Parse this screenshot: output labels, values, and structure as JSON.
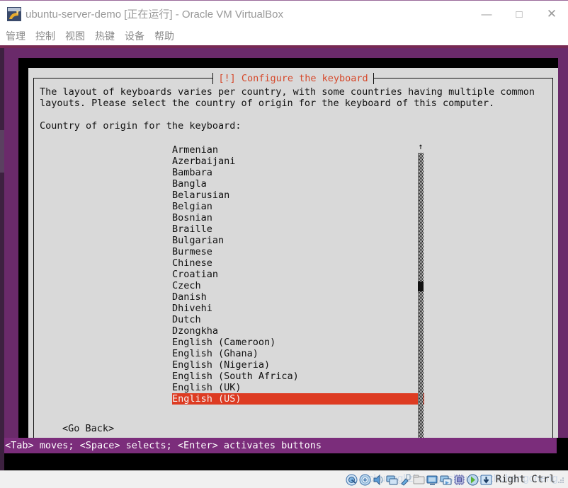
{
  "window": {
    "title": "ubuntu-server-demo [正在运行] - Oracle VM VirtualBox",
    "logo_icon": "virtualbox-logo-icon",
    "minimize_label": "—",
    "maximize_label": "□",
    "close_label": "✕",
    "minimize_icon": "minimize-icon",
    "maximize_icon": "maximize-icon",
    "close_icon": "close-icon"
  },
  "menubar": {
    "items": [
      {
        "label": "管理"
      },
      {
        "label": "控制"
      },
      {
        "label": "视图"
      },
      {
        "label": "热键"
      },
      {
        "label": "设备"
      },
      {
        "label": "帮助"
      }
    ]
  },
  "dialog": {
    "title": "[!] Configure the keyboard",
    "title_color": "#d6482a",
    "body_text": "The layout of keyboards varies per country, with some countries having multiple common\nlayouts. Please select the country of origin for the keyboard of this computer.",
    "prompt": "Country of origin for the keyboard:",
    "go_back_label": "<Go Back>",
    "selected_value": "English (US)",
    "highlight_color": "#dd3b22",
    "panel_color": "#d9d9d9",
    "list": [
      {
        "label": "Armenian",
        "selected": false
      },
      {
        "label": "Azerbaijani",
        "selected": false
      },
      {
        "label": "Bambara",
        "selected": false
      },
      {
        "label": "Bangla",
        "selected": false
      },
      {
        "label": "Belarusian",
        "selected": false
      },
      {
        "label": "Belgian",
        "selected": false
      },
      {
        "label": "Bosnian",
        "selected": false
      },
      {
        "label": "Braille",
        "selected": false
      },
      {
        "label": "Bulgarian",
        "selected": false
      },
      {
        "label": "Burmese",
        "selected": false
      },
      {
        "label": "Chinese",
        "selected": false
      },
      {
        "label": "Croatian",
        "selected": false
      },
      {
        "label": "Czech",
        "selected": false
      },
      {
        "label": "Danish",
        "selected": false
      },
      {
        "label": "Dhivehi",
        "selected": false
      },
      {
        "label": "Dutch",
        "selected": false
      },
      {
        "label": "Dzongkha",
        "selected": false
      },
      {
        "label": "English (Cameroon)",
        "selected": false
      },
      {
        "label": "English (Ghana)",
        "selected": false
      },
      {
        "label": "English (Nigeria)",
        "selected": false
      },
      {
        "label": "English (South Africa)",
        "selected": false
      },
      {
        "label": "English (UK)",
        "selected": false
      },
      {
        "label": "English (US)",
        "selected": true
      }
    ],
    "scrollbar": {
      "up_arrow": "↑",
      "down_arrow": "↓",
      "thumb_position_percent": 46
    }
  },
  "hintbar": {
    "text": "<Tab> moves; <Space> selects; <Enter> activates buttons",
    "background_color": "#7b2d7b"
  },
  "statusbar": {
    "watermark": "chuanglizhuanyeshouyouzhuhangcheng",
    "host_key": "Right Ctrl",
    "icons": [
      {
        "name": "hard-disk-icon"
      },
      {
        "name": "optical-disk-icon"
      },
      {
        "name": "audio-icon"
      },
      {
        "name": "network-icon"
      },
      {
        "name": "usb-icon"
      },
      {
        "name": "shared-folders-icon"
      },
      {
        "name": "display-icon"
      },
      {
        "name": "recording-icon"
      },
      {
        "name": "virtualization-icon"
      },
      {
        "name": "mouse-integration-icon"
      },
      {
        "name": "host-key-icon"
      }
    ],
    "resize_grip_icon": "resize-grip-icon"
  }
}
